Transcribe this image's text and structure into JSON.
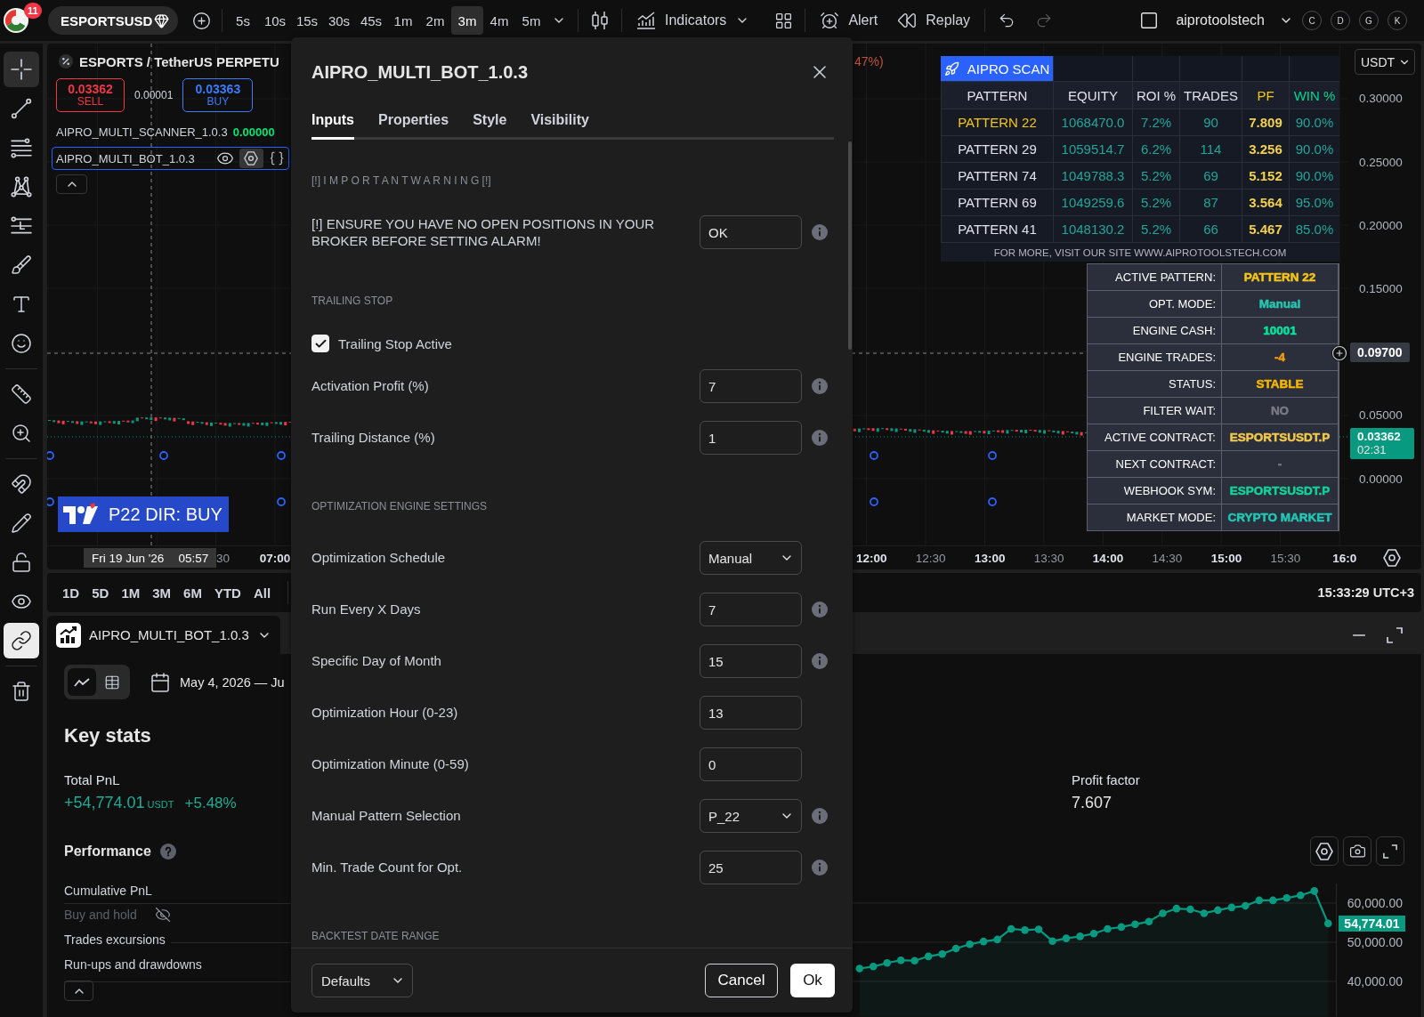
{
  "top_bar": {
    "badge": "11",
    "symbol": "ESPORTSUSD",
    "intervals": [
      {
        "label": "5s",
        "selected": false
      },
      {
        "label": "10s",
        "selected": false
      },
      {
        "label": "15s",
        "selected": false
      },
      {
        "label": "30s",
        "selected": false
      },
      {
        "label": "45s",
        "selected": false
      },
      {
        "label": "1m",
        "selected": false
      },
      {
        "label": "2m",
        "selected": false
      },
      {
        "label": "3m",
        "selected": true
      },
      {
        "label": "4m",
        "selected": false
      },
      {
        "label": "5m",
        "selected": false
      }
    ],
    "indicators": "Indicators",
    "alert": "Alert",
    "replay": "Replay",
    "history": [
      {
        "kind": "undo",
        "disabled": false
      },
      {
        "kind": "redo",
        "disabled": true
      }
    ],
    "layout_name": "aiprotoolstech",
    "chips": [
      "C",
      "D",
      "G",
      "K"
    ]
  },
  "left_toolbar": {
    "groups": [
      {
        "tools": [
          {
            "kind": "crosshair",
            "selected": true,
            "on": false
          },
          {
            "kind": "trend_line",
            "selected": false,
            "on": false
          },
          {
            "kind": "horizontal_lines",
            "selected": false,
            "on": false
          },
          {
            "kind": "pattern",
            "selected": false,
            "on": false
          },
          {
            "kind": "measure",
            "selected": false,
            "on": false
          },
          {
            "kind": "brush",
            "selected": false,
            "on": false
          },
          {
            "kind": "text",
            "selected": false,
            "on": false
          },
          {
            "kind": "emoji",
            "selected": false,
            "on": false
          }
        ]
      },
      {
        "tools": [
          {
            "kind": "ruler",
            "selected": false,
            "on": false
          },
          {
            "kind": "zoom",
            "selected": false,
            "on": false
          }
        ]
      },
      {
        "tools": [
          {
            "kind": "magnet",
            "selected": false,
            "on": false
          },
          {
            "kind": "pencil",
            "selected": false,
            "on": false
          },
          {
            "kind": "lock",
            "selected": false,
            "on": false
          },
          {
            "kind": "eye",
            "selected": false,
            "on": false
          },
          {
            "kind": "link",
            "selected": false,
            "on": true
          }
        ]
      },
      {
        "tools": [
          {
            "kind": "trash",
            "selected": false,
            "on": false
          }
        ]
      }
    ]
  },
  "chart": {
    "legend": {
      "title": "ESPORTS / TetherUS PERPETU",
      "change_tail": "47%)",
      "sell": {
        "price": "0.03362",
        "label": "SELL"
      },
      "spread": "0.00001",
      "buy": {
        "price": "0.03363",
        "label": "BUY"
      },
      "studies": [
        {
          "name": "AIPRO_MULTI_SCANNER_1.0.3",
          "value": "0.00000",
          "selected": false
        },
        {
          "name": "AIPRO_MULTI_BOT_1.0.3",
          "selected": true
        }
      ]
    },
    "signal_label": "P22 DIR: BUY",
    "scan_table": {
      "title": "AIPRO SCAN",
      "columns": [
        {
          "label": "PATTERN",
          "kind": "name"
        },
        {
          "label": "EQUITY",
          "kind": "equity"
        },
        {
          "label": "ROI %",
          "kind": "percent"
        },
        {
          "label": "TRADES",
          "kind": "count"
        },
        {
          "label": "PF",
          "kind": "factor"
        },
        {
          "label": "WIN %",
          "kind": "rate"
        }
      ],
      "rows": [
        {
          "selected": true,
          "cells": [
            "PATTERN 22",
            "1068470.0",
            "7.2%",
            "90",
            "7.809",
            "90.0%"
          ]
        },
        {
          "selected": false,
          "cells": [
            "PATTERN 29",
            "1059514.7",
            "6.2%",
            "114",
            "3.256",
            "90.0%"
          ]
        },
        {
          "selected": false,
          "cells": [
            "PATTERN 74",
            "1049788.3",
            "5.2%",
            "69",
            "5.152",
            "90.0%"
          ]
        },
        {
          "selected": false,
          "cells": [
            "PATTERN 69",
            "1049259.6",
            "5.2%",
            "87",
            "3.564",
            "95.0%"
          ]
        },
        {
          "selected": false,
          "cells": [
            "PATTERN 41",
            "1048130.2",
            "5.2%",
            "66",
            "5.467",
            "85.0%"
          ]
        }
      ],
      "footer": "FOR MORE, VISIT OUR SITE WWW.AIPROTOOLSTECH.COM"
    },
    "status_table": [
      {
        "label": "ACTIVE PATTERN:",
        "value": "PATTERN 22",
        "color": "#f5c518"
      },
      {
        "label": "OPT. MODE:",
        "value": "Manual",
        "color": "#26c6b0"
      },
      {
        "label": "ENGINE CASH:",
        "value": "10001",
        "color": "#00e5a0"
      },
      {
        "label": "ENGINE TRADES:",
        "value": "-4",
        "color": "#f59e0b"
      },
      {
        "label": "STATUS:",
        "value": "STABLE",
        "color": "#f5b700"
      },
      {
        "label": "FILTER WAIT:",
        "value": "NO",
        "color": "#787b86"
      },
      {
        "label": "ACTIVE CONTRACT:",
        "value": "ESPORTSUSDT.P",
        "color": "#f2c94c"
      },
      {
        "label": "NEXT CONTRACT:",
        "value": "-",
        "color": "#787b86"
      },
      {
        "label": "WEBHOOK SYM:",
        "value": "ESPORTSUSDT.P",
        "color": "#14d39a"
      },
      {
        "label": "MARKET MODE:",
        "value": "CRYPTO MARKET",
        "color": "#22c8b5"
      }
    ],
    "price_axis": {
      "currency": "USDT",
      "ticks": [
        {
          "kind": "tick",
          "label": "0.30000"
        },
        {
          "kind": "tick",
          "label": "0.25000"
        },
        {
          "kind": "tick",
          "label": "0.20000"
        },
        {
          "kind": "tick",
          "label": "0.15000"
        },
        {
          "kind": "crosshair",
          "label": "0.09700"
        },
        {
          "kind": "tick",
          "label": "0.05000"
        },
        {
          "kind": "tick",
          "label": "0.00000"
        }
      ],
      "last_price": "0.03362",
      "countdown": "02:31"
    },
    "time_axis": {
      "crosshair_date": "Fri 19 Jun '26",
      "crosshair_time": "05:57",
      "left_labels": [
        {
          "label": "30",
          "major": false
        },
        {
          "label": "07:00",
          "major": true
        }
      ],
      "right_labels": [
        {
          "label": "12:00",
          "major": true
        },
        {
          "label": "12:30",
          "major": false
        },
        {
          "label": "13:00",
          "major": true
        },
        {
          "label": "13:30",
          "major": false
        },
        {
          "label": "14:00",
          "major": true
        },
        {
          "label": "14:30",
          "major": false
        },
        {
          "label": "15:00",
          "major": true
        },
        {
          "label": "15:30",
          "major": false
        },
        {
          "label": "16:0",
          "major": true
        }
      ]
    }
  },
  "range_bar": {
    "ranges": [
      "1D",
      "5D",
      "1M",
      "3M",
      "6M",
      "YTD",
      "All"
    ],
    "clock": "15:33:29 UTC+3"
  },
  "strategy_panel": {
    "tab_title": "AIPRO_MULTI_BOT_1.0.3",
    "view_toggle": [
      {
        "kind": "chart",
        "selected": true
      },
      {
        "kind": "table",
        "selected": false
      }
    ],
    "date_range": "May 4, 2026 — Ju",
    "heading": "Key stats",
    "stats": [
      {
        "kind": "pnl",
        "label": "Total PnL",
        "value": "+54,774.01",
        "unit": "USDT",
        "change": "+5.48%"
      },
      {
        "kind": "plain",
        "label": "Profit factor",
        "value": "7.607"
      }
    ],
    "performance_title": "Performance",
    "series_toggles": [
      {
        "label": "Cumulative PnL",
        "visible": true
      },
      {
        "label": "Buy and hold",
        "visible": false
      },
      {
        "label": "Trades excursions",
        "visible": true
      },
      {
        "label": "Run-ups and drawdowns",
        "visible": true
      }
    ],
    "equity_chart": {
      "last_value": "54,774.01",
      "chart_data": {
        "type": "area",
        "categories": [
          null,
          null,
          null,
          null,
          null,
          null,
          null,
          null,
          null,
          null,
          null,
          null,
          null,
          null,
          null,
          null,
          null,
          null,
          null,
          null,
          null,
          null,
          null,
          null,
          null,
          null,
          null,
          null,
          null,
          null,
          null,
          null,
          null,
          null,
          null
        ],
        "grid": true,
        "ylim": [
          31000,
          65000
        ],
        "yticks": [
          {
            "value": 40000,
            "label": "40,000.00"
          },
          {
            "value": 50000,
            "label": "50,000.00"
          },
          {
            "value": 60000,
            "label": "60,000.00"
          }
        ],
        "series": [
          {
            "color": "#089981",
            "values": [
              43300,
              43800,
              44700,
              45400,
              45300,
              46400,
              47000,
              48400,
              49500,
              50200,
              50700,
              53400,
              53100,
              53300,
              50300,
              51000,
              51500,
              52200,
              53400,
              53900,
              54600,
              55300,
              57400,
              58600,
              58400,
              57400,
              58200,
              58900,
              59300,
              60700,
              60700,
              61300,
              62000,
              63100,
              54800
            ]
          }
        ]
      }
    }
  },
  "dialog": {
    "title": "AIPRO_MULTI_BOT_1.0.3",
    "tabs": [
      {
        "label": "Inputs",
        "selected": true
      },
      {
        "label": "Properties",
        "selected": false
      },
      {
        "label": "Style",
        "selected": false
      },
      {
        "label": "Visibility",
        "selected": false
      }
    ],
    "sections": [
      {
        "heading": "[!] I M P O R T A N T W A R N I N G [!]",
        "fields": [
          {
            "kind": "text",
            "label": "[!] ENSURE YOU HAVE NO OPEN POSITIONS IN YOUR BROKER BEFORE SETTING ALARM!",
            "value": "OK",
            "info": true
          }
        ]
      },
      {
        "heading": "TRAILING STOP",
        "fields": [
          {
            "kind": "checkbox",
            "label": "Trailing Stop Active",
            "checked": true
          },
          {
            "kind": "text",
            "label": "Activation Profit (%)",
            "value": "7",
            "info": true
          },
          {
            "kind": "text",
            "label": "Trailing Distance (%)",
            "value": "1",
            "info": true
          }
        ]
      },
      {
        "heading": "OPTIMIZATION ENGINE SETTINGS",
        "fields": [
          {
            "kind": "select",
            "label": "Optimization Schedule",
            "value": "Manual",
            "info": false
          },
          {
            "kind": "text",
            "label": "Run Every X Days",
            "value": "7",
            "info": true
          },
          {
            "kind": "text",
            "label": "Specific Day of Month",
            "value": "15",
            "info": true
          },
          {
            "kind": "text",
            "label": "Optimization Hour (0-23)",
            "value": "13",
            "info": false
          },
          {
            "kind": "text",
            "label": "Optimization Minute (0-59)",
            "value": "0",
            "info": false
          },
          {
            "kind": "select",
            "label": "Manual Pattern Selection",
            "value": "P_22",
            "info": true
          },
          {
            "kind": "text",
            "label": "Min. Trade Count for Opt.",
            "value": "25",
            "info": true
          }
        ]
      },
      {
        "heading": "BACKTEST DATE RANGE"
      }
    ],
    "footer": {
      "defaults": "Defaults",
      "cancel": "Cancel",
      "ok": "Ok"
    }
  }
}
